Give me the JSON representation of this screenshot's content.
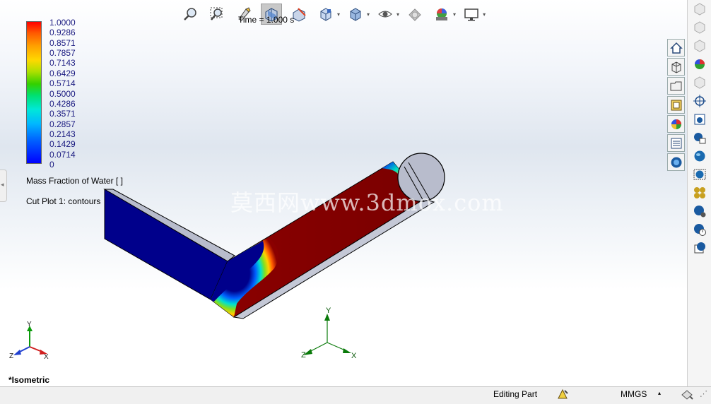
{
  "toolbar": {
    "time_label": "Time = 1.000 s",
    "buttons": [
      {
        "name": "zoom-to-fit",
        "icon": "zoom-fit-icon",
        "dropdown": false
      },
      {
        "name": "zoom-to-area",
        "icon": "zoom-area-icon",
        "dropdown": false
      },
      {
        "name": "previous-view",
        "icon": "previous-view-icon",
        "dropdown": false
      },
      {
        "name": "section-view",
        "icon": "section-view-icon",
        "dropdown": false,
        "selected": true
      },
      {
        "name": "dynamic-annotation",
        "icon": "annotation-view-icon",
        "dropdown": false
      },
      {
        "name": "view-orientation",
        "icon": "view-orientation-cube-icon",
        "dropdown": true
      },
      {
        "name": "display-style",
        "icon": "display-style-icon",
        "dropdown": true
      },
      {
        "name": "hide-show-items",
        "icon": "eye-icon",
        "dropdown": true
      },
      {
        "name": "edit-appearance",
        "icon": "appearance-icon",
        "dropdown": false
      },
      {
        "name": "apply-scene",
        "icon": "scene-icon",
        "dropdown": true
      },
      {
        "name": "view-settings",
        "icon": "monitor-icon",
        "dropdown": true
      }
    ]
  },
  "legend": {
    "ticks": [
      "1.0000",
      "0.9286",
      "0.8571",
      "0.7857",
      "0.7143",
      "0.6429",
      "0.5714",
      "0.5000",
      "0.4286",
      "0.3571",
      "0.2857",
      "0.2143",
      "0.1429",
      "0.0714",
      "0"
    ],
    "title": "Mass Fraction of Water [ ]",
    "colors": [
      "#ff0000",
      "#ffa000",
      "#ffd800",
      "#33d000",
      "#00e8d8",
      "#00b8ff",
      "#0000ff"
    ]
  },
  "plot": {
    "cut_label": "Cut Plot 1: contours",
    "body_colors": {
      "blue": "#00008b",
      "red": "#8b0000",
      "face": "#b8bccc"
    }
  },
  "triad_center": {
    "x": "X",
    "y": "Y",
    "z": "Z"
  },
  "triad_corner": {
    "x": "X",
    "y": "Y",
    "z": "Z"
  },
  "watermark": "莫西网www.3dmox.com",
  "view": {
    "name": "*Isometric"
  },
  "dv_bar": [
    "home-icon",
    "parts-icon",
    "folder-icon",
    "design-library-icon",
    "appearance-icon",
    "property-list-icon",
    "flow-simulation-icon"
  ],
  "task_pane": [
    "cube-icon",
    "cube-icon",
    "cube-icon",
    "appearance-icon",
    "cube-icon",
    "target-icon",
    "camera-icon",
    "camera-settings-icon",
    "globe-icon",
    "globe-frame-icon",
    "cluster-icon",
    "gear-globe-icon",
    "clock-globe-icon",
    "save-globe-icon"
  ],
  "status": {
    "editing": "Editing Part",
    "rebuild_icon": "rebuild-icon",
    "units": "MMGS",
    "customize_icon": "customize-icon"
  }
}
